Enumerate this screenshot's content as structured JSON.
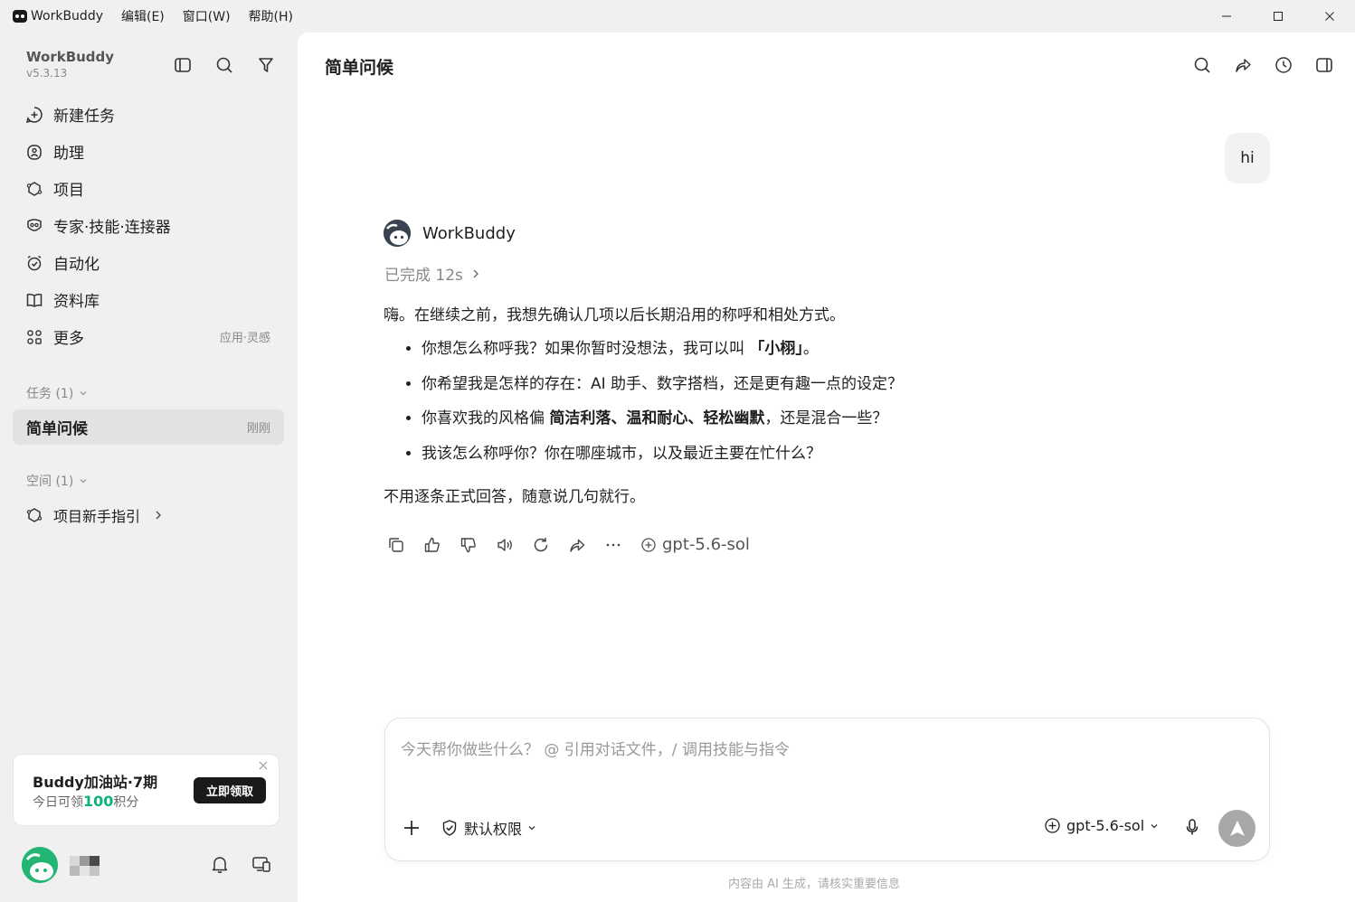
{
  "titlebar": {
    "app_name": "WorkBuddy",
    "menu": [
      "编辑(E)",
      "窗口(W)",
      "帮助(H)"
    ]
  },
  "sidebar": {
    "brand_name": "WorkBuddy",
    "version": "v5.3.13",
    "nav": [
      {
        "label": "新建任务",
        "icon": "new-task-icon"
      },
      {
        "label": "助理",
        "icon": "assistant-icon"
      },
      {
        "label": "项目",
        "icon": "project-icon"
      },
      {
        "label": "专家·技能·连接器",
        "icon": "expert-icon"
      },
      {
        "label": "自动化",
        "icon": "automation-icon"
      },
      {
        "label": "资料库",
        "icon": "library-icon"
      },
      {
        "label": "更多",
        "icon": "more-apps-icon",
        "extra": "应用·灵感"
      }
    ],
    "tasks_label": "任务 (1)",
    "task": {
      "title": "简单问候",
      "time": "刚刚"
    },
    "spaces_label": "空间 (1)",
    "space": {
      "title": "项目新手指引"
    },
    "promo": {
      "title": "Buddy加油站·7期",
      "sub_prefix": "今日可领",
      "sub_num": "100",
      "sub_suffix": "积分",
      "button": "立即领取"
    }
  },
  "main": {
    "title": "简单问候",
    "user_message": "hi",
    "bot_name": "WorkBuddy",
    "status": "已完成 12s",
    "answer": {
      "intro": "嗨。在继续之前，我想先确认几项以后长期沿用的称呼和相处方式。",
      "bullets": [
        {
          "pre": "你想怎么称呼我？如果你暂时没想法，我可以叫 ",
          "bold": "「小栩」",
          "post": "。"
        },
        {
          "pre": "你希望我是怎样的存在：AI 助手、数字搭档，还是更有趣一点的设定？",
          "bold": "",
          "post": ""
        },
        {
          "pre": "你喜欢我的风格偏 ",
          "bold": "简洁利落、温和耐心、轻松幽默",
          "post": "，还是混合一些？"
        },
        {
          "pre": "我该怎么称呼你？你在哪座城市，以及最近主要在忙什么？",
          "bold": "",
          "post": ""
        }
      ],
      "closing": "不用逐条正式回答，随意说几句就行。"
    },
    "action_model": "gpt-5.6-sol",
    "composer": {
      "placeholder": "今天帮你做些什么？ @ 引用对话文件，/ 调用技能与指令",
      "permission": "默认权限",
      "model": "gpt-5.6-sol"
    },
    "disclaimer": "内容由 AI 生成，请核实重要信息"
  },
  "colors": {
    "accent_green": "#0bb37b",
    "sidebar_bg": "#f0f0f0",
    "selected_task_bg": "#e2e2e2",
    "send_button": "#a8a8a8"
  }
}
